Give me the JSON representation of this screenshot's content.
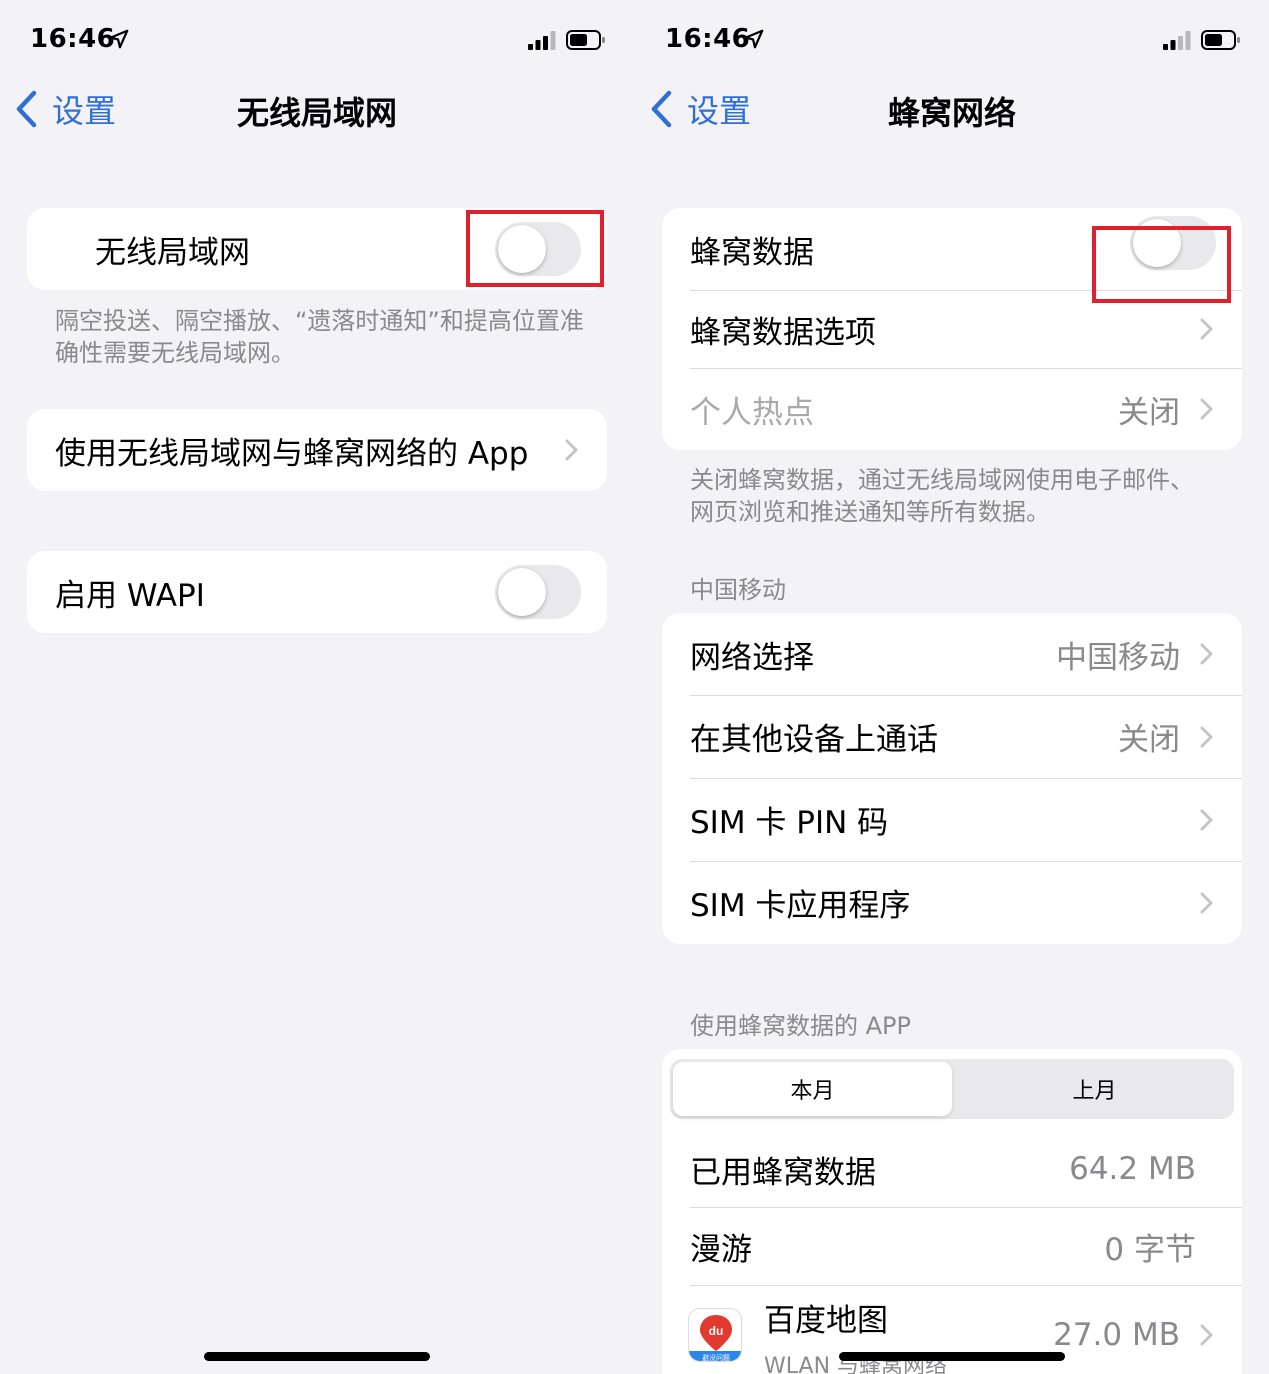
{
  "left": {
    "status": {
      "time": "16:46"
    },
    "nav": {
      "back": "设置",
      "title": "无线局域网"
    },
    "wlan_row": {
      "label": "无线局域网",
      "toggle_on": false
    },
    "wlan_footnote": "隔空投送、隔空播放、“遗落时通知”和提高位置准确性需要无线局域网。",
    "apps_row": {
      "label": "使用无线局域网与蜂窝网络的 App"
    },
    "wapi_row": {
      "label": "启用 WAPI",
      "toggle_on": false
    }
  },
  "right": {
    "status": {
      "time": "16:46"
    },
    "nav": {
      "back": "设置",
      "title": "蜂窝网络"
    },
    "cellular_data": {
      "label": "蜂窝数据",
      "toggle_on": false
    },
    "cellular_options": {
      "label": "蜂窝数据选项"
    },
    "hotspot": {
      "label": "个人热点",
      "value": "关闭"
    },
    "cellular_footnote": "关闭蜂窝数据，通过无线局域网使用电子邮件、网页浏览和推送通知等所有数据。",
    "carrier_header": "中国移动",
    "network_selection": {
      "label": "网络选择",
      "value": "中国移动"
    },
    "calls_other_devices": {
      "label": "在其他设备上通话",
      "value": "关闭"
    },
    "sim_pin": {
      "label": "SIM 卡 PIN 码"
    },
    "sim_apps": {
      "label": "SIM 卡应用程序"
    },
    "apps_header": "使用蜂窝数据的 APP",
    "segment": {
      "this_month": "本月",
      "last_month": "上月",
      "selected": "本月"
    },
    "used_data": {
      "label": "已用蜂窝数据",
      "value": "64.2 MB"
    },
    "roaming": {
      "label": "漫游",
      "value": "0 字节"
    },
    "app_baidu": {
      "name": "百度地图",
      "sub": "WLAN 与蜂窝网络",
      "value": "27.0 MB",
      "icon_text": "du",
      "icon_caption": "避没问题"
    }
  },
  "colors": {
    "accent": "#2f6fd6",
    "highlight": "#e0202c",
    "toggle_off": "#e9e9eb",
    "background": "#f2f2f7"
  }
}
